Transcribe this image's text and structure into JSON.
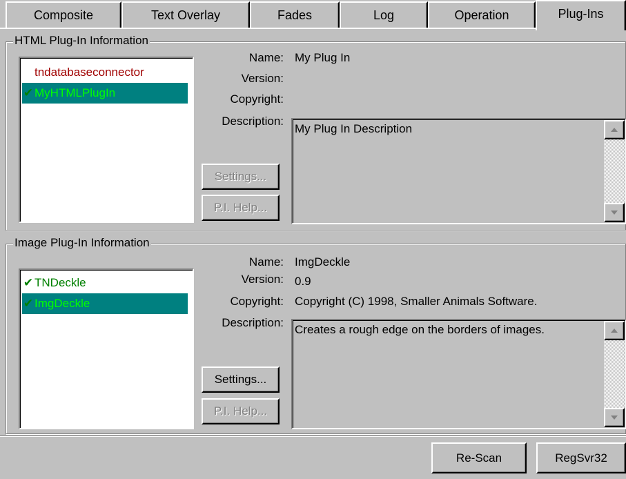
{
  "tabs": [
    {
      "label": "Composite"
    },
    {
      "label": "Text Overlay"
    },
    {
      "label": "Fades"
    },
    {
      "label": "Log"
    },
    {
      "label": "Operation"
    },
    {
      "label": "Plug-Ins",
      "active": true
    }
  ],
  "html_group": {
    "title": "HTML Plug-In Information",
    "plugins": [
      {
        "label": "tndatabaseconnector",
        "checked": false,
        "color": "#a00000"
      },
      {
        "label": "MyHTMLPlugIn",
        "checked": true,
        "selected": true,
        "color": "#00ff00"
      }
    ],
    "labels": {
      "name": "Name:",
      "version": "Version:",
      "copyright": "Copyright:",
      "description": "Description:"
    },
    "values": {
      "name": "My Plug In",
      "version": "",
      "copyright": "",
      "description": "My Plug In Description"
    },
    "settings_label": "Settings...",
    "help_label": "P.I. Help..."
  },
  "image_group": {
    "title": "Image Plug-In Information",
    "plugins": [
      {
        "label": "TNDeckle",
        "checked": true,
        "color": "#008000"
      },
      {
        "label": "ImgDeckle",
        "checked": true,
        "selected": true,
        "color": "#00ff00"
      }
    ],
    "labels": {
      "name": "Name:",
      "version": "Version:",
      "copyright": "Copyright:",
      "description": "Description:"
    },
    "values": {
      "name": "ImgDeckle",
      "version": "0.9",
      "copyright": "Copyright (C) 1998, Smaller Animals Software.",
      "description": "Creates a rough edge on the borders of images."
    },
    "settings_label": "Settings...",
    "help_label": "P.I. Help..."
  },
  "footer": {
    "rescan_label": "Re-Scan",
    "regsvr_label": "RegSvr32"
  },
  "colors": {
    "face": "#c0c0c0",
    "selection": "#008080",
    "check": "#008000"
  }
}
